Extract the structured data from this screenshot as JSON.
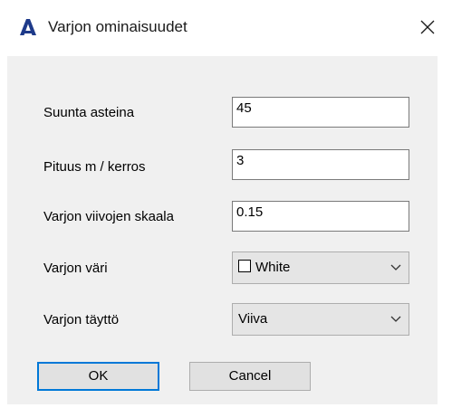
{
  "window": {
    "title": "Varjon ominaisuudet",
    "icon": "autocad-a-icon",
    "close_glyph": "✕"
  },
  "form": {
    "direction_label": "Suunta asteina",
    "direction_value": "45",
    "length_label": "Pituus  m / kerros",
    "length_value": "3",
    "scale_label": "Varjon viivojen skaala",
    "scale_value": "0.15",
    "color_label": "Varjon väri",
    "color_value": "White",
    "fill_label": "Varjon täyttö",
    "fill_value": "Viiva"
  },
  "buttons": {
    "ok_label": "OK",
    "cancel_label": "Cancel"
  },
  "colors": {
    "dialog_bg": "#f0f0f0",
    "focus_border": "#0078d7",
    "icon_color": "#1e3a8a"
  }
}
